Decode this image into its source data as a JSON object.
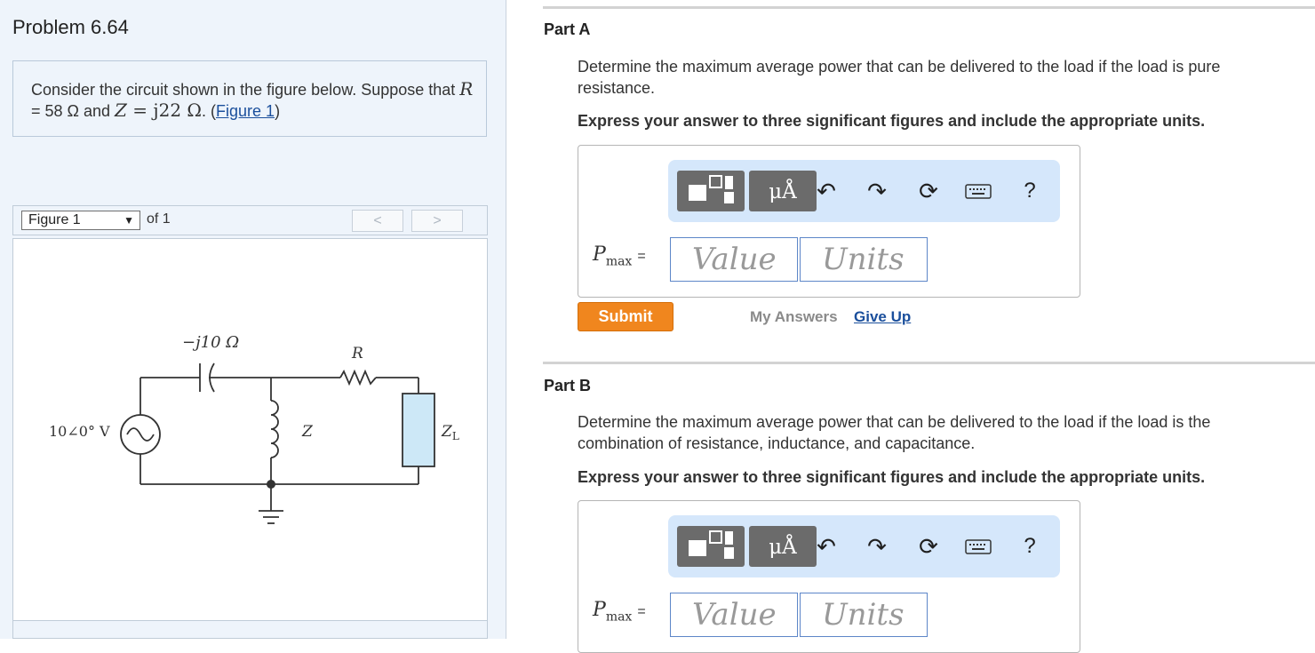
{
  "problem": {
    "title": "Problem 6.64",
    "intro_prefix": "Consider the circuit shown in the figure below. Suppose that ",
    "R_symbol": "R",
    "R_value": " = 58  Ω",
    "and": " and ",
    "Z_symbol": "Z",
    "Z_value": " = j22 Ω",
    "period": ". (",
    "figure_link": "Figure 1",
    "close": ")"
  },
  "figure_nav": {
    "selected": "Figure 1",
    "of": "of 1",
    "prev": "<",
    "next": ">"
  },
  "circuit": {
    "capacitor_label": "−j10 Ω",
    "resistor_label": "R",
    "inductor_label": "Z",
    "load_label": "Z",
    "load_sub": "L",
    "source_label": "10∠0° V"
  },
  "parts": [
    {
      "title": "Part A",
      "question": "Determine the maximum average power that can be delivered to the load if the load is pure resistance.",
      "instruction": "Express your answer to three significant figures and include the appropriate units.",
      "answer_label": "P",
      "answer_sub": "max",
      "eq": "=",
      "value_placeholder": "Value",
      "units_placeholder": "Units"
    },
    {
      "title": "Part B",
      "question": "Determine the maximum average power that can be delivered to the load if the load is the combination of resistance, inductance, and capacitance.",
      "instruction": "Express your answer to three significant figures and include the appropriate units.",
      "answer_label": "P",
      "answer_sub": "max",
      "eq": "=",
      "value_placeholder": "Value",
      "units_placeholder": "Units"
    }
  ],
  "toolbar": {
    "units_button": "μÅ",
    "help": "?",
    "icons": [
      "templates-icon",
      "units-icon",
      "undo-icon",
      "redo-icon",
      "reset-icon",
      "keyboard-icon",
      "help-icon"
    ]
  },
  "actions": {
    "submit": "Submit",
    "my_answers": "My Answers",
    "give_up": "Give Up"
  },
  "colors": {
    "panel_bg": "#eef4fb",
    "toolbar_bg": "#d5e7fb",
    "submit": "#f0861e",
    "link": "#1b4f9c",
    "field_border": "#5d86c8"
  }
}
